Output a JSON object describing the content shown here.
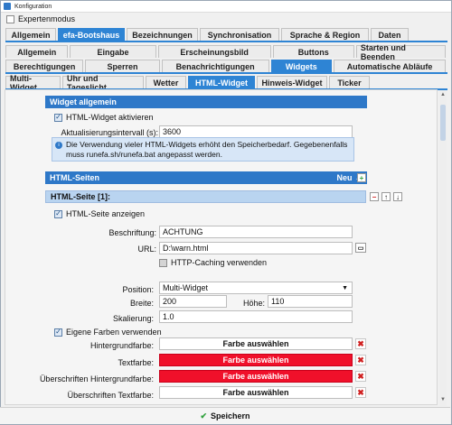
{
  "window": {
    "title": "Konfiguration"
  },
  "expert_mode": {
    "label": "Expertenmodus",
    "checked": false
  },
  "tabs_main": [
    "Allgemein",
    "efa-Bootshaus",
    "Bezeichnungen",
    "Synchronisation",
    "Sprache & Region",
    "Daten"
  ],
  "tabs_sub1": [
    "Allgemein",
    "Eingabe",
    "Erscheinungsbild",
    "Buttons",
    "Starten und Beenden"
  ],
  "tabs_sub2": [
    "Berechtigungen",
    "Sperren",
    "Benachrichtigungen",
    "Widgets",
    "Automatische Abläufe"
  ],
  "tabs_widgets": [
    "Multi-Widget",
    "Uhr und Tageslicht",
    "Wetter",
    "HTML-Widget",
    "Hinweis-Widget",
    "Ticker"
  ],
  "section_general": {
    "title": "Widget allgemein",
    "activate_label": "HTML-Widget aktivieren",
    "interval_label": "Aktualisierungsintervall (s):",
    "interval_value": "3600",
    "info_text": "Die Verwendung vieler HTML-Widgets erhöht den Speicherbedarf. Gegebenenfalls muss runefa.sh/runefa.bat angepasst werden."
  },
  "html_pages": {
    "title": "HTML-Seiten",
    "new_label": "Neu →",
    "add_symbol": "+"
  },
  "page1": {
    "title": "HTML-Seite [1]:",
    "remove_symbol": "−",
    "up_symbol": "↑",
    "down_symbol": "↓",
    "show_label": "HTML-Seite anzeigen",
    "description_label": "Beschriftung:",
    "description_value": "ACHTUNG",
    "url_label": "URL:",
    "url_value": "D:\\warn.html",
    "caching_label": "HTTP-Caching verwenden",
    "position_label": "Position:",
    "position_value": "Multi-Widget",
    "width_label": "Breite:",
    "width_value": "200",
    "height_label": "Höhe:",
    "height_value": "110",
    "scale_label": "Skalierung:",
    "scale_value": "1.0",
    "own_colors_label": "Eigene Farben verwenden",
    "choose_color_label": "Farbe auswählen",
    "bg_label": "Hintergrundfarbe:",
    "text_label": "Textfarbe:",
    "heading_bg_label": "Überschriften Hintergrundfarbe:",
    "heading_text_label": "Überschriften Textfarbe:",
    "clear_symbol": "✖"
  },
  "footer": {
    "save_label": "Speichern"
  },
  "colors": {
    "accent": "#2e84d4",
    "red": "#f0102a",
    "green_check": "#2ea03c"
  }
}
